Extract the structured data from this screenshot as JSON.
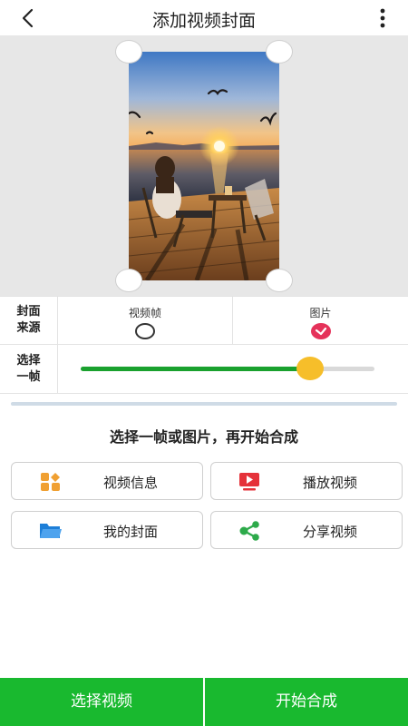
{
  "header": {
    "title": "添加视频封面",
    "back_icon": "chevron-left-icon",
    "more_icon": "more-vertical-icon"
  },
  "options": {
    "source_label": "封面来源",
    "source_label_line1": "封面",
    "source_label_line2": "来源",
    "source_video_frame": "视频帧",
    "source_image": "图片",
    "selected_source": "图片",
    "frame_label_line1": "选择",
    "frame_label_line2": "一帧",
    "frame_position_fraction": 0.78
  },
  "instruction": "选择一帧或图片，再开始合成",
  "actions": [
    {
      "label": "视频信息",
      "icon": "video-info-icon",
      "color": "#f0a032"
    },
    {
      "label": "播放视频",
      "icon": "play-video-icon",
      "color": "#e5323a"
    },
    {
      "label": "我的封面",
      "icon": "folder-icon",
      "color": "#1e7fd8"
    },
    {
      "label": "分享视频",
      "icon": "share-icon",
      "color": "#2daa4a"
    }
  ],
  "bottom": {
    "select_video": "选择视频",
    "start_compose": "开始合成"
  },
  "colors": {
    "accent_green": "#19b92f",
    "slider_green": "#1aa12e",
    "slider_thumb": "#f6be2a",
    "radio_selected": "#e5325a"
  }
}
